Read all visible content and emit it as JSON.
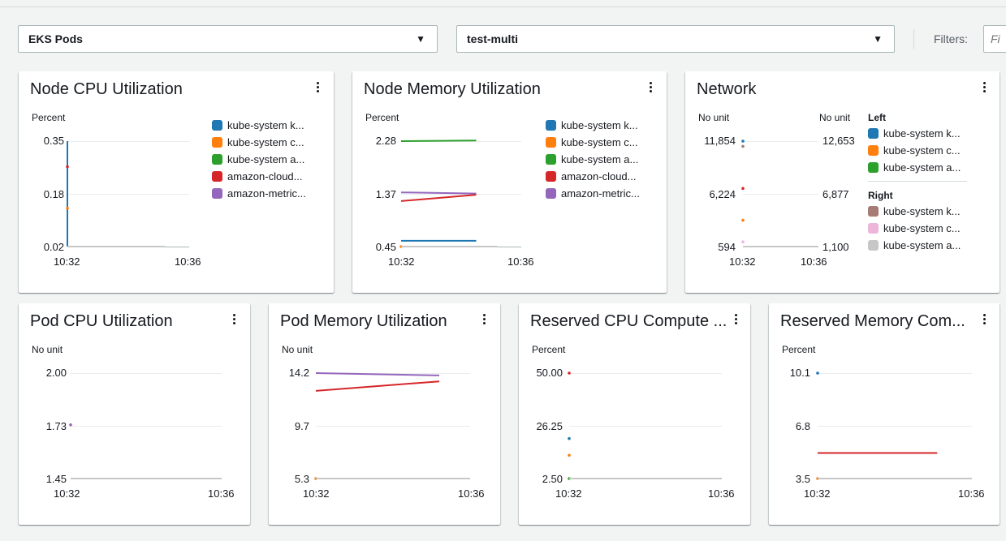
{
  "colors": {
    "blue": "#1f77b4",
    "orange": "#ff7f0e",
    "green": "#2ca02c",
    "red": "#d62728",
    "purple": "#9467bd",
    "brown": "#a67c76",
    "pink": "#ecb5da",
    "gray": "#c7c7c7"
  },
  "toolbar": {
    "dashboard_select": "EKS Pods",
    "cluster_select": "test-multi",
    "filters_label": "Filters:",
    "filters_placeholder": "Fi"
  },
  "series_names": [
    "kube-system k...",
    "kube-system c...",
    "kube-system a...",
    "amazon-cloud...",
    "amazon-metric..."
  ],
  "widgets": {
    "node_cpu": {
      "title": "Node CPU Utilization",
      "unit": "Percent",
      "yticks": [
        "0.35",
        "0.18",
        "0.02"
      ],
      "xticks": [
        "10:32",
        "10:36"
      ]
    },
    "node_mem": {
      "title": "Node Memory Utilization",
      "unit": "Percent",
      "yticks": [
        "2.28",
        "1.37",
        "0.45"
      ],
      "xticks": [
        "10:32",
        "10:36"
      ]
    },
    "network": {
      "title": "Network",
      "unit_left": "No unit",
      "unit_right": "No unit",
      "yticks_left": [
        "11,854",
        "6,224",
        "594"
      ],
      "yticks_right": [
        "12,653",
        "6,877",
        "1,100"
      ],
      "xticks": [
        "10:32",
        "10:36"
      ],
      "legend_left_heading": "Left",
      "legend_right_heading": "Right",
      "legend_left": [
        "kube-system k...",
        "kube-system c...",
        "kube-system a..."
      ],
      "legend_right": [
        "kube-system k...",
        "kube-system c...",
        "kube-system a..."
      ]
    },
    "pod_cpu": {
      "title": "Pod CPU Utilization",
      "unit": "No unit",
      "yticks": [
        "2.00",
        "1.73",
        "1.45"
      ],
      "xticks": [
        "10:32",
        "10:36"
      ]
    },
    "pod_mem": {
      "title": "Pod Memory Utilization",
      "unit": "No unit",
      "yticks": [
        "14.2",
        "9.7",
        "5.3"
      ],
      "xticks": [
        "10:32",
        "10:36"
      ]
    },
    "res_cpu": {
      "title": "Reserved CPU Compute ...",
      "unit": "Percent",
      "yticks": [
        "50.00",
        "26.25",
        "2.50"
      ],
      "xticks": [
        "10:32",
        "10:36"
      ]
    },
    "res_mem": {
      "title": "Reserved Memory Com...",
      "unit": "Percent",
      "yticks": [
        "10.1",
        "6.8",
        "3.5"
      ],
      "xticks": [
        "10:32",
        "10:36"
      ]
    }
  },
  "chart_data": [
    {
      "type": "line",
      "title": "Node CPU Utilization",
      "ylabel": "Percent",
      "ylim": [
        0.02,
        0.35
      ],
      "x": [
        "10:32",
        "10:36"
      ],
      "series": [
        {
          "name": "kube-system k...",
          "color": "blue",
          "points": [
            [
              0,
              0.35
            ],
            [
              0,
              0.02
            ]
          ]
        },
        {
          "name": "amazon-cloud...",
          "color": "red",
          "points": [
            [
              0,
              0.27
            ]
          ]
        },
        {
          "name": "kube-system c...",
          "color": "orange",
          "points": [
            [
              0,
              0.14
            ]
          ]
        },
        {
          "name": "kube-system a...",
          "color": "gray",
          "points": [
            [
              0,
              0.02
            ],
            [
              3.2,
              0.02
            ]
          ]
        }
      ]
    },
    {
      "type": "line",
      "title": "Node Memory Utilization",
      "ylabel": "Percent",
      "ylim": [
        0.45,
        2.28
      ],
      "x": [
        "10:32",
        "10:36"
      ],
      "series": [
        {
          "name": "kube-system a...",
          "color": "green",
          "points": [
            [
              0,
              2.28
            ],
            [
              2.5,
              2.29
            ]
          ]
        },
        {
          "name": "amazon-metric...",
          "color": "purple",
          "points": [
            [
              0,
              1.39
            ],
            [
              2.5,
              1.37
            ]
          ]
        },
        {
          "name": "amazon-cloud...",
          "color": "red",
          "points": [
            [
              0,
              1.24
            ],
            [
              2.5,
              1.35
            ]
          ]
        },
        {
          "name": "kube-system k...",
          "color": "blue",
          "points": [
            [
              0,
              0.55
            ],
            [
              2.5,
              0.55
            ]
          ]
        },
        {
          "name": "kube-system c...",
          "color": "orange",
          "points": [
            [
              0,
              0.45
            ]
          ]
        },
        {
          "name": "kube-system a...",
          "color": "gray",
          "points": [
            [
              0,
              0.45
            ],
            [
              3.2,
              0.45
            ]
          ]
        }
      ]
    },
    {
      "type": "line",
      "title": "Network",
      "ylabel": "No unit",
      "ylim": [
        594,
        11854
      ],
      "x": [
        "10:32",
        "10:36"
      ],
      "series": [
        {
          "name": "kube-system k...",
          "color": "blue",
          "points": [
            [
              0,
              11854
            ]
          ]
        },
        {
          "name": "kube-system c...",
          "color": "orange",
          "points": [
            [
              0,
              3400
            ]
          ]
        },
        {
          "name": "amazon-cloud...",
          "color": "red",
          "points": [
            [
              0,
              6800
            ]
          ]
        },
        {
          "name": "kube-system k...",
          "color": "brown",
          "points": [
            [
              0,
              11300
            ]
          ]
        },
        {
          "name": "kube-system c...",
          "color": "pink",
          "points": [
            [
              0,
              1100
            ]
          ]
        },
        {
          "name": "kube-system a...",
          "color": "gray",
          "points": [
            [
              0,
              594
            ],
            [
              4,
              594
            ]
          ]
        }
      ]
    },
    {
      "type": "line",
      "title": "Pod CPU Utilization",
      "ylabel": "No unit",
      "ylim": [
        1.45,
        2.0
      ],
      "x": [
        "10:32",
        "10:36"
      ],
      "series": [
        {
          "name": "kube-system k...",
          "color": "purple",
          "points": [
            [
              0,
              1.73
            ]
          ]
        },
        {
          "name": "kube-system a...",
          "color": "gray",
          "points": [
            [
              0,
              1.45
            ],
            [
              4,
              1.45
            ]
          ]
        }
      ]
    },
    {
      "type": "line",
      "title": "Pod Memory Utilization",
      "ylabel": "No unit",
      "ylim": [
        5.3,
        14.2
      ],
      "x": [
        "10:32",
        "10:36"
      ],
      "series": [
        {
          "name": "amazon-metric...",
          "color": "purple",
          "points": [
            [
              0,
              14.2
            ],
            [
              3.2,
              14.0
            ]
          ]
        },
        {
          "name": "amazon-cloud...",
          "color": "red",
          "points": [
            [
              0,
              12.7
            ],
            [
              3.2,
              13.5
            ]
          ]
        },
        {
          "name": "kube-system c...",
          "color": "orange",
          "points": [
            [
              0,
              5.3
            ]
          ]
        },
        {
          "name": "kube-system a...",
          "color": "gray",
          "points": [
            [
              0,
              5.3
            ],
            [
              4,
              5.3
            ]
          ]
        }
      ]
    },
    {
      "type": "line",
      "title": "Reserved CPU Compute ...",
      "ylabel": "Percent",
      "ylim": [
        2.5,
        50.0
      ],
      "x": [
        "10:32",
        "10:36"
      ],
      "series": [
        {
          "name": "amazon-cloud...",
          "color": "red",
          "points": [
            [
              0,
              50.0
            ]
          ]
        },
        {
          "name": "kube-system k...",
          "color": "blue",
          "points": [
            [
              0,
              20.5
            ]
          ]
        },
        {
          "name": "kube-system c...",
          "color": "orange",
          "points": [
            [
              0,
              13.0
            ]
          ]
        },
        {
          "name": "kube-system a...",
          "color": "green",
          "points": [
            [
              0,
              2.5
            ]
          ]
        },
        {
          "name": "kube-system a...",
          "color": "gray",
          "points": [
            [
              0,
              2.5
            ],
            [
              4,
              2.5
            ]
          ]
        }
      ]
    },
    {
      "type": "line",
      "title": "Reserved Memory Com...",
      "ylabel": "Percent",
      "ylim": [
        3.5,
        10.1
      ],
      "x": [
        "10:32",
        "10:36"
      ],
      "series": [
        {
          "name": "kube-system k...",
          "color": "blue",
          "points": [
            [
              0,
              10.1
            ]
          ]
        },
        {
          "name": "amazon-cloud...",
          "color": "red",
          "points": [
            [
              0,
              5.1
            ],
            [
              3.1,
              5.1
            ]
          ]
        },
        {
          "name": "kube-system c...",
          "color": "orange",
          "points": [
            [
              0,
              3.5
            ]
          ]
        },
        {
          "name": "kube-system a...",
          "color": "gray",
          "points": [
            [
              0,
              3.5
            ],
            [
              4,
              3.5
            ]
          ]
        }
      ]
    }
  ]
}
